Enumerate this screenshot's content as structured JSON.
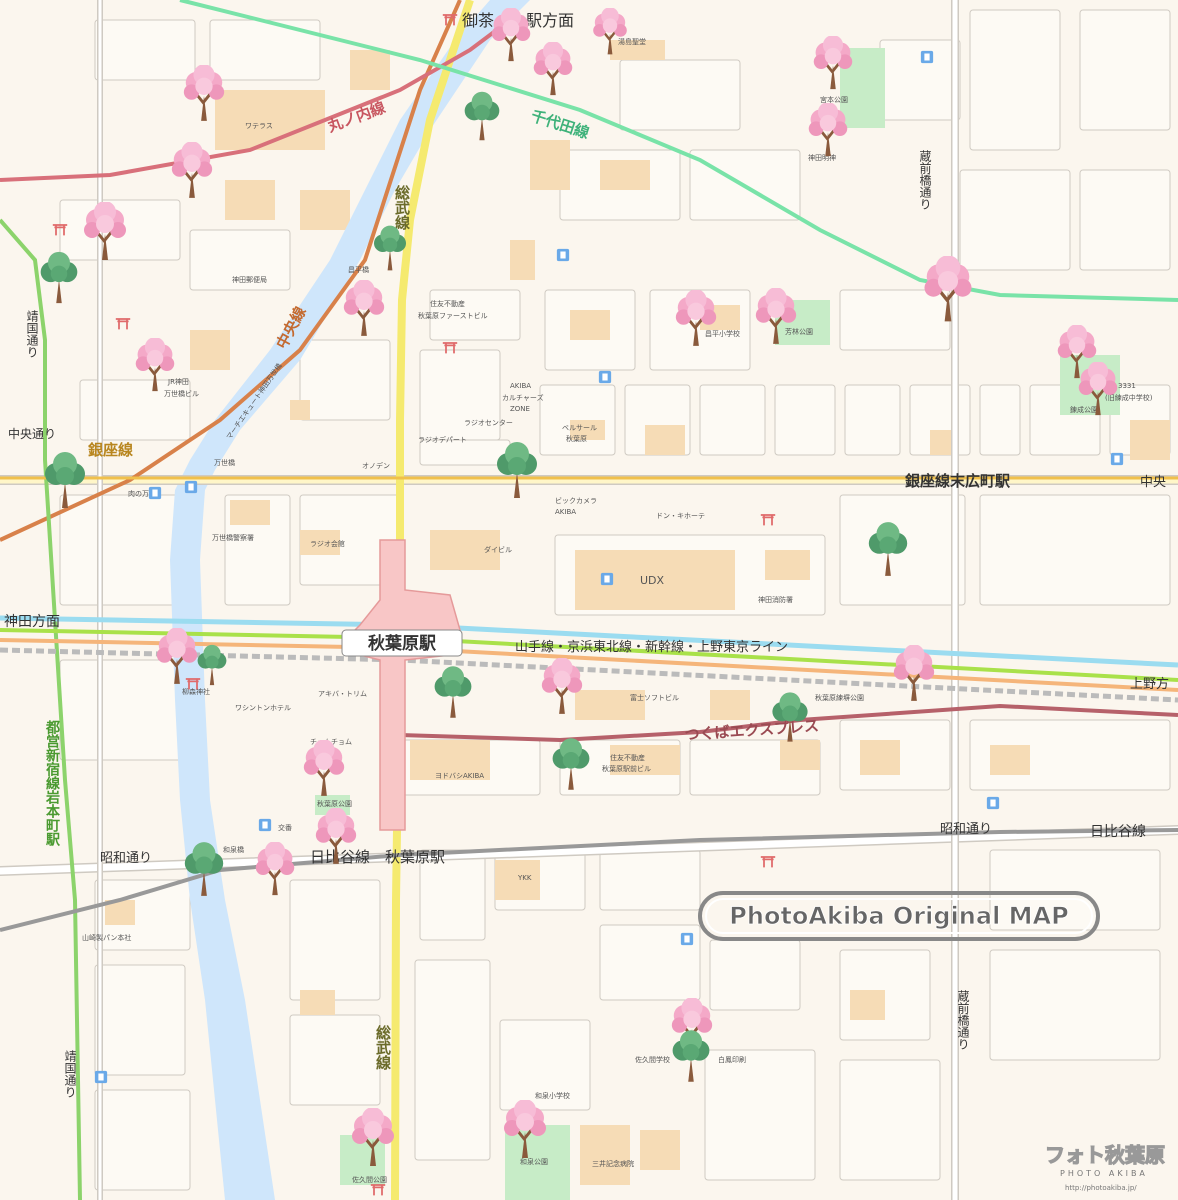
{
  "map": {
    "colors": {
      "background": "#fbf6ee",
      "road": "#ffffff",
      "road_edge": "#cfcac2",
      "major_road": "#f7e37a",
      "building": "#f6dcb6",
      "park": "#c7ecc7",
      "river": "#cfe6fb",
      "marunouchi": "#d8707a",
      "chiyoda": "#79e3a8",
      "chuo": "#d8814a",
      "sobu": "#f5ea6f",
      "ginza": "#f0c04c",
      "hibiya": "#999999",
      "shinjuku": "#8cd36b",
      "tsukuba": "#b6616a",
      "yamanote_green": "#a9e14a",
      "yamanote_orange": "#f5b57a",
      "keihin_blue": "#9bdcf0",
      "station_fill": "#f8c6c6"
    },
    "watermark": "PhotoAkiba Original MAP",
    "logo_text": "フォト秋葉原",
    "logo_subtitle": "PHOTO AKIBA",
    "logo_url": "http://photoakiba.jp/"
  },
  "labels": {
    "ochanomizu": "御茶ノ水駅方面",
    "marunouchi": "丸ノ内線",
    "chiyoda": "千代田線",
    "sobu_top": "総武線",
    "chuo_line": "中央線",
    "chuo_dori_left": "中央通り",
    "ginza_line": "銀座線",
    "suehirocho": "銀座線末広町駅",
    "chuo_right": "中央",
    "kanda_direction": "神田方面",
    "akihabara_station": "秋葉原駅",
    "yamanote": "山手線・京浜東北線・新幹線・上野東京ライン",
    "ueno_direction": "上野方",
    "tsukuba": "つくばエクスプレス",
    "showa_left": "昭和通り",
    "showa_right": "昭和通り",
    "hibiya_right": "日比谷線",
    "hibiya_akihabara": "日比谷線　秋葉原駅",
    "shinjuku_line": "都営新宿線岩本町駅",
    "sobu_bottom": "総武線",
    "kuramae_top": "蔵前橋通り",
    "kuramae_bottom": "蔵前橋通り",
    "yasukuni_top": "靖国通り",
    "yasukuni_bottom": "靖国通り"
  },
  "places": [
    {
      "name": "ワテラス"
    },
    {
      "name": "湯島聖堂"
    },
    {
      "name": "宮本公園"
    },
    {
      "name": "神田明神"
    },
    {
      "name": "神田郵便局"
    },
    {
      "name": "昌平橋"
    },
    {
      "name": "住友不動産"
    },
    {
      "name": "秋葉原ファーストビル"
    },
    {
      "name": "昌平小学校"
    },
    {
      "name": "芳林公園"
    },
    {
      "name": "JR神田"
    },
    {
      "name": "万世橋ビル"
    },
    {
      "name": "3331"
    },
    {
      "name": "(旧練成中学校)"
    },
    {
      "name": "錬成公園"
    },
    {
      "name": "AKIBA"
    },
    {
      "name": "カルチャーズ"
    },
    {
      "name": "ZONE"
    },
    {
      "name": "ベルサール"
    },
    {
      "name": "秋葉原"
    },
    {
      "name": "ラジオデパート"
    },
    {
      "name": "ラジオセンター"
    },
    {
      "name": "オノデン"
    },
    {
      "name": "マーチエキュート神田万世橋"
    },
    {
      "name": "万世橋"
    },
    {
      "name": "肉の万世"
    },
    {
      "name": "ビックカメラ"
    },
    {
      "name": "AKIBA"
    },
    {
      "name": "ドン・キホーテ"
    },
    {
      "name": "万世橋警察署"
    },
    {
      "name": "ラジオ会館"
    },
    {
      "name": "ダイビル"
    },
    {
      "name": "UDX"
    },
    {
      "name": "神田消防署"
    },
    {
      "name": "柳森神社"
    },
    {
      "name": "アキバ・トリム"
    },
    {
      "name": "ワシントンホテル"
    },
    {
      "name": "富士ソフトビル"
    },
    {
      "name": "秋葉原練塀公園"
    },
    {
      "name": "チョムチョム"
    },
    {
      "name": "ヨドバシAKIBA"
    },
    {
      "name": "住友不動産"
    },
    {
      "name": "秋葉原駅前ビル"
    },
    {
      "name": "秋葉原公園"
    },
    {
      "name": "和泉橋"
    },
    {
      "name": "YKK"
    },
    {
      "name": "山崎製パン本社"
    },
    {
      "name": "佐久間公園"
    },
    {
      "name": "和泉小学校"
    },
    {
      "name": "和泉公園"
    },
    {
      "name": "三井記念病院"
    },
    {
      "name": "白鳳印刷"
    },
    {
      "name": "佐久間学校"
    },
    {
      "name": "交番"
    }
  ]
}
